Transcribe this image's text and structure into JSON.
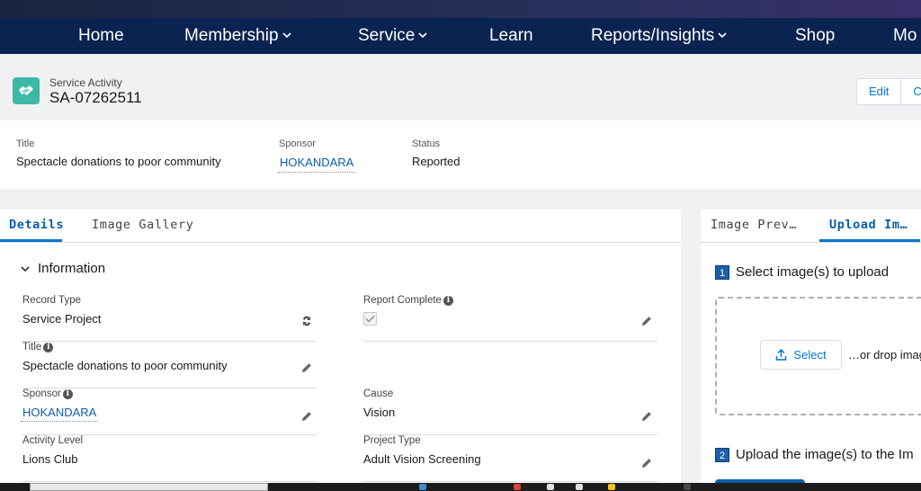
{
  "nav": {
    "items": [
      {
        "label": "Home",
        "has_menu": false
      },
      {
        "label": "Membership",
        "has_menu": true
      },
      {
        "label": "Service",
        "has_menu": true
      },
      {
        "label": "Learn",
        "has_menu": false
      },
      {
        "label": "Reports/Insights",
        "has_menu": true
      },
      {
        "label": "Shop",
        "has_menu": false
      },
      {
        "label": "Mo",
        "has_menu": false
      }
    ]
  },
  "record": {
    "object_label": "Service Activity",
    "name": "SA-07262511",
    "icon": "handshake-icon",
    "actions": [
      {
        "label": "Edit"
      },
      {
        "label": "C"
      }
    ]
  },
  "highlights": {
    "title_label": "Title",
    "title_value": "Spectacle donations to poor community",
    "sponsor_label": "Sponsor",
    "sponsor_value": "HOKANDARA",
    "status_label": "Status",
    "status_value": "Reported"
  },
  "tabs": [
    {
      "label": "Details",
      "active": true
    },
    {
      "label": "Image Gallery",
      "active": false
    }
  ],
  "section": {
    "title": "Information"
  },
  "fields": {
    "record_type": {
      "label": "Record Type",
      "value": "Service Project"
    },
    "report_complete": {
      "label": "Report Complete",
      "checked": true
    },
    "title": {
      "label": "Title",
      "value": "Spectacle donations to poor community"
    },
    "sponsor": {
      "label": "Sponsor",
      "value": "HOKANDARA"
    },
    "cause": {
      "label": "Cause",
      "value": "Vision"
    },
    "activity_level": {
      "label": "Activity Level",
      "value": "Lions Club"
    },
    "project_type": {
      "label": "Project Type",
      "value": "Adult Vision Screening"
    }
  },
  "side": {
    "tabs": [
      {
        "label": "Image Prev…",
        "active": false
      },
      {
        "label": "Upload Im…",
        "active": true
      }
    ],
    "step1": {
      "num": "1",
      "text": "Select image(s) to upload"
    },
    "select_button": "Select",
    "drop_text": "…or drop imag",
    "step2": {
      "num": "2",
      "text": "Upload the image(s) to the Im"
    }
  },
  "colors": {
    "nav_bg": "#0b2350",
    "accent": "#0176d3",
    "record_icon": "#3bb8a6"
  }
}
